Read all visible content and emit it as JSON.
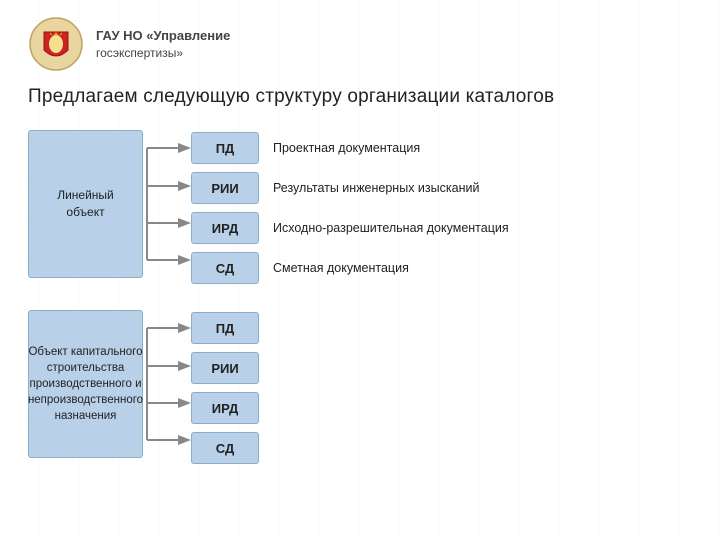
{
  "header": {
    "org_line1": "ГАУ НО «Управление",
    "org_line2": "госэкспертизы»"
  },
  "page_title": "Предлагаем следующую структуру организации каталогов",
  "section1": {
    "category_label": "Линейный объект",
    "docs": [
      {
        "code": "ПД",
        "description": "Проектная документация"
      },
      {
        "code": "РИИ",
        "description": "Результаты инженерных изысканий"
      },
      {
        "code": "ИРД",
        "description": "Исходно-разрешительная документация"
      },
      {
        "code": "СД",
        "description": "Сметная документация"
      }
    ]
  },
  "section2": {
    "category_label": "Объект капитального строительства производственного и непроизводственного назначения",
    "docs": [
      {
        "code": "ПД"
      },
      {
        "code": "РИИ"
      },
      {
        "code": "ИРД"
      },
      {
        "code": "СД"
      }
    ]
  }
}
